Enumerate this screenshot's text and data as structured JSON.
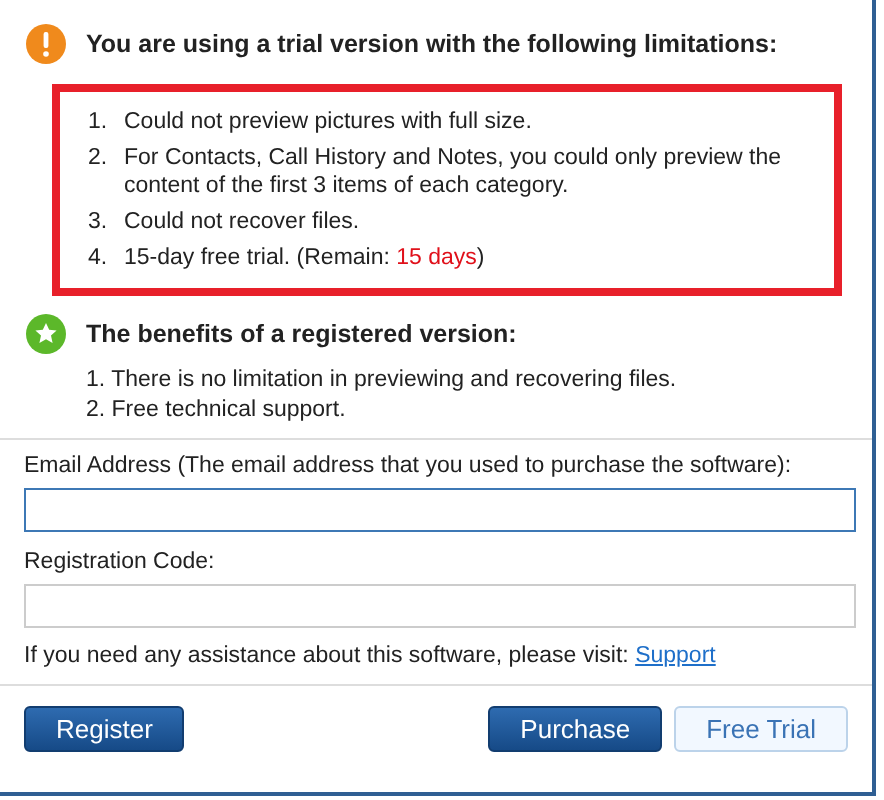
{
  "limitations": {
    "heading": "You are using a trial version with the following limitations:",
    "items": [
      {
        "number": "1.",
        "text": "Could not preview pictures with full size."
      },
      {
        "number": "2.",
        "text": "For Contacts, Call History and Notes, you could only preview the content of the first 3 items of each category."
      },
      {
        "number": "3.",
        "text": "Could not recover files."
      },
      {
        "number": "4.",
        "text": "15-day free trial. (Remain: ",
        "highlight": "15 days",
        "tail": ")"
      }
    ]
  },
  "benefits": {
    "heading": "The benefits of a registered version:",
    "items": [
      "1. There is no limitation in previewing and recovering files.",
      "2. Free technical support."
    ]
  },
  "form": {
    "email_label": "Email Address (The email address that you used to purchase the software):",
    "registration_label": "Registration Code:",
    "help_text": "If you need any assistance about this software, please visit:",
    "help_link": "Support"
  },
  "buttons": {
    "register": "Register",
    "purchase": "Purchase",
    "free_trial": "Free Trial"
  }
}
